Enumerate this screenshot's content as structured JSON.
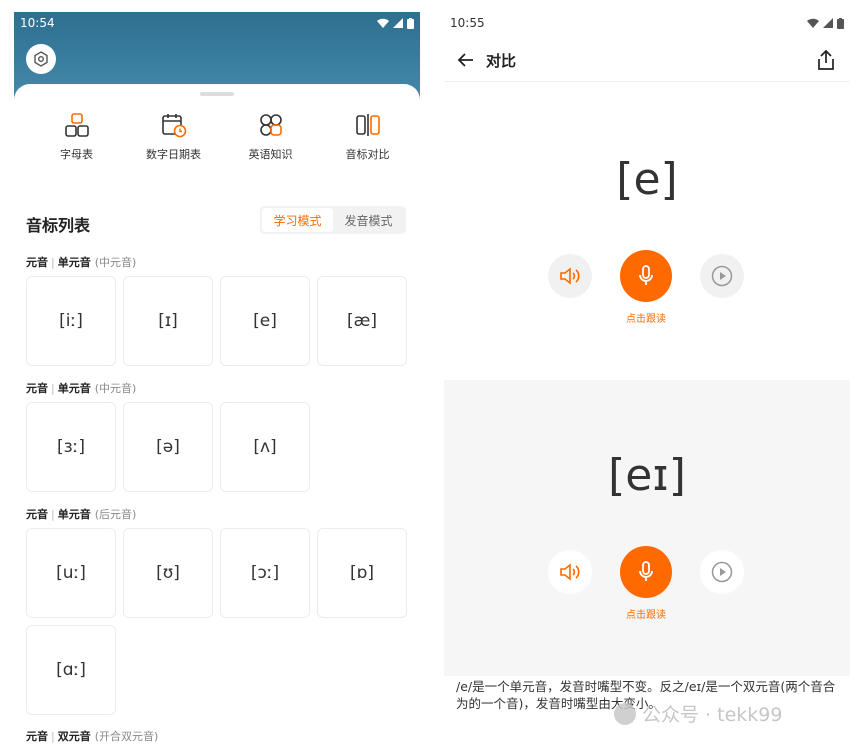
{
  "left": {
    "status": {
      "time": "10:54"
    },
    "quick_nav": [
      {
        "label": "字母表",
        "icon": "alphabet-icon"
      },
      {
        "label": "数字日期表",
        "icon": "calendar-icon"
      },
      {
        "label": "英语知识",
        "icon": "knowledge-icon"
      },
      {
        "label": "音标对比",
        "icon": "compare-icon"
      }
    ],
    "list_title": "音标列表",
    "modes": [
      "学习模式",
      "发音模式"
    ],
    "sections": [
      {
        "category": "元音",
        "type": "单元音",
        "note": "(中元音)",
        "cards": [
          "[iː]",
          "[ɪ]",
          "[e]",
          "[æ]"
        ]
      },
      {
        "category": "元音",
        "type": "单元音",
        "note": "(中元音)",
        "cards": [
          "[ɜː]",
          "[ə]",
          "[ʌ]"
        ]
      },
      {
        "category": "元音",
        "type": "单元音",
        "note": "(后元音)",
        "cards": [
          "[uː]",
          "[ʊ]",
          "[ɔː]",
          "[ɒ]",
          "[ɑː]"
        ]
      },
      {
        "category": "元音",
        "type": "双元音",
        "note": "(开合双元音)"
      }
    ],
    "accent": "#ff6a00",
    "header_color": "#3a7ea0"
  },
  "right": {
    "status": {
      "time": "10:55"
    },
    "title": "对比",
    "panels": [
      {
        "ipa": "[e]",
        "record_label": "点击跟读"
      },
      {
        "ipa": "[eɪ]",
        "record_label": "点击跟读"
      }
    ],
    "description": "/e/是一个单元音，发音时嘴型不变。反之/eɪ/是一个双元音(两个音合为的一个音)，发音时嘴型由大变小。"
  },
  "watermark": "公众号 · tekk99"
}
